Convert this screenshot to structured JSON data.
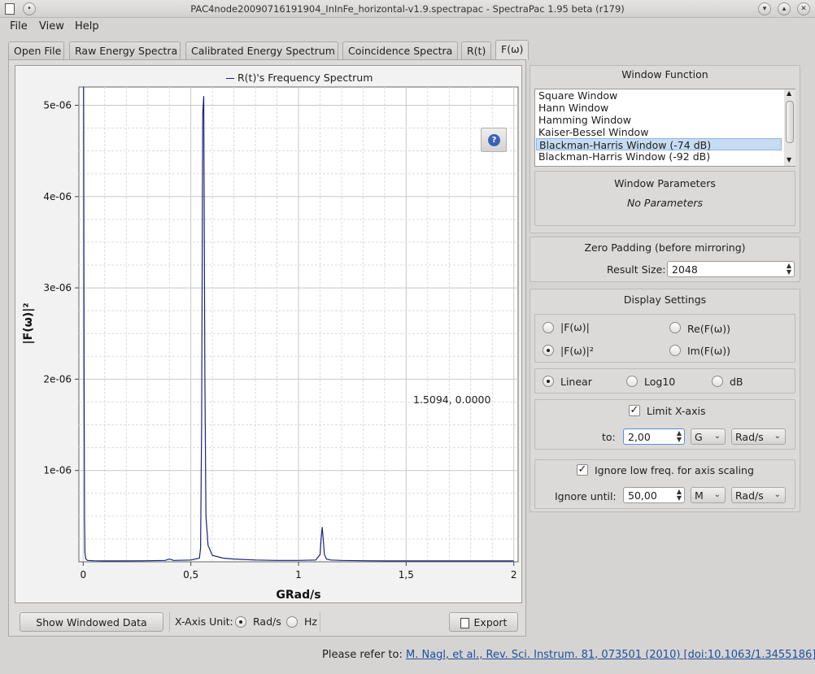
{
  "window": {
    "title": "PAC4node20090716191904_InInFe_horizontal-v1.9.spectrapac - SpectraPac 1.95 beta (r179)"
  },
  "menu": {
    "file": "File",
    "view": "View",
    "help": "Help"
  },
  "tabs": [
    {
      "label": "Open File"
    },
    {
      "label": "Raw Energy Spectra"
    },
    {
      "label": "Calibrated Energy Spectrum"
    },
    {
      "label": "Coincidence Spectra"
    },
    {
      "label": "R(t)"
    },
    {
      "label": "F(ω)"
    }
  ],
  "chart_data": {
    "type": "line",
    "title": "",
    "legend": [
      "R(t)'s Frequency Spectrum"
    ],
    "xlabel": "GRad/s",
    "ylabel": "|F(ω)|²",
    "xlim": [
      -0.02,
      2.02
    ],
    "ylim": [
      0,
      5.2e-06
    ],
    "grid": true,
    "xticks": [
      "0",
      "0,5",
      "1",
      "1,5",
      "2"
    ],
    "yticks": [
      "1e-06",
      "2e-06",
      "3e-06",
      "4e-06",
      "5e-06"
    ],
    "series": [
      {
        "name": "R(t)'s Frequency Spectrum",
        "color": "#1a237e",
        "x": [
          0.0,
          0.002,
          0.004,
          0.006,
          0.008,
          0.012,
          0.02,
          0.05,
          0.1,
          0.2,
          0.3,
          0.38,
          0.4,
          0.42,
          0.5,
          0.54,
          0.545,
          0.55,
          0.555,
          0.56,
          0.565,
          0.57,
          0.58,
          0.6,
          0.65,
          0.7,
          0.8,
          0.9,
          1.0,
          1.08,
          1.1,
          1.105,
          1.11,
          1.115,
          1.12,
          1.13,
          1.15,
          1.2,
          1.3,
          1.4,
          1.5,
          1.6,
          1.8,
          2.0
        ],
        "y": [
          5.2e-06,
          5.2e-06,
          2e-06,
          5e-07,
          1e-07,
          3e-08,
          1.5e-08,
          1.2e-08,
          1e-08,
          1e-08,
          1.2e-08,
          1.5e-08,
          3e-08,
          1.5e-08,
          2e-08,
          4e-08,
          1.5e-07,
          1.5e-06,
          4.9e-06,
          5.1e-06,
          2e-06,
          5e-07,
          1.8e-07,
          7e-08,
          4e-08,
          3e-08,
          2e-08,
          1.5e-08,
          1.5e-08,
          2e-08,
          8e-08,
          2.5e-07,
          3.8e-07,
          2.5e-07,
          8e-08,
          3e-08,
          2e-08,
          1.5e-08,
          1.2e-08,
          1e-08,
          1e-08,
          1e-08,
          1e-08,
          1e-08
        ]
      }
    ]
  },
  "plot": {
    "coordinate_readout": "1.5094, 0.0000"
  },
  "bottom": {
    "show_windowed": "Show Windowed Data",
    "xaxis_unit_label": "X-Axis Unit:",
    "unit_rads": "Rad/s",
    "unit_hz": "Hz",
    "selected_unit": "Rad/s",
    "export": "Export"
  },
  "window_function": {
    "title": "Window Function",
    "items": [
      "Square Window",
      "Hann Window",
      "Hamming Window",
      "Kaiser-Bessel Window",
      "Blackman-Harris Window (-74 dB)",
      "Blackman-Harris Window (-92 dB)"
    ],
    "selected_index": 4
  },
  "window_parameters": {
    "title": "Window Parameters",
    "text": "No Parameters"
  },
  "zero_padding": {
    "title": "Zero Padding (before mirroring)",
    "label": "Result Size:",
    "value": "2048"
  },
  "display_settings": {
    "title": "Display Settings",
    "options": [
      "|F(ω)|",
      "Re(F(ω))",
      "|F(ω)|²",
      "Im(F(ω))"
    ],
    "selected": "|F(ω)|²",
    "scales": [
      "Linear",
      "Log10",
      "dB"
    ],
    "selected_scale": "Linear"
  },
  "limit_x": {
    "label": "Limit X-axis",
    "checked": true,
    "to_label": "to:",
    "value": "2,00",
    "prefix": "G",
    "unit": "Rad/s"
  },
  "ignore_low": {
    "label": "Ignore low freq. for axis scaling",
    "checked": true,
    "until_label": "Ignore until:",
    "value": "50,00",
    "prefix": "M",
    "unit": "Rad/s"
  },
  "status": {
    "prefix": "Please refer to:",
    "link": "M. Nagl, et al., Rev. Sci. Instrum. 81, 073501 (2010) [doi:10.1063/1.3455186]"
  }
}
